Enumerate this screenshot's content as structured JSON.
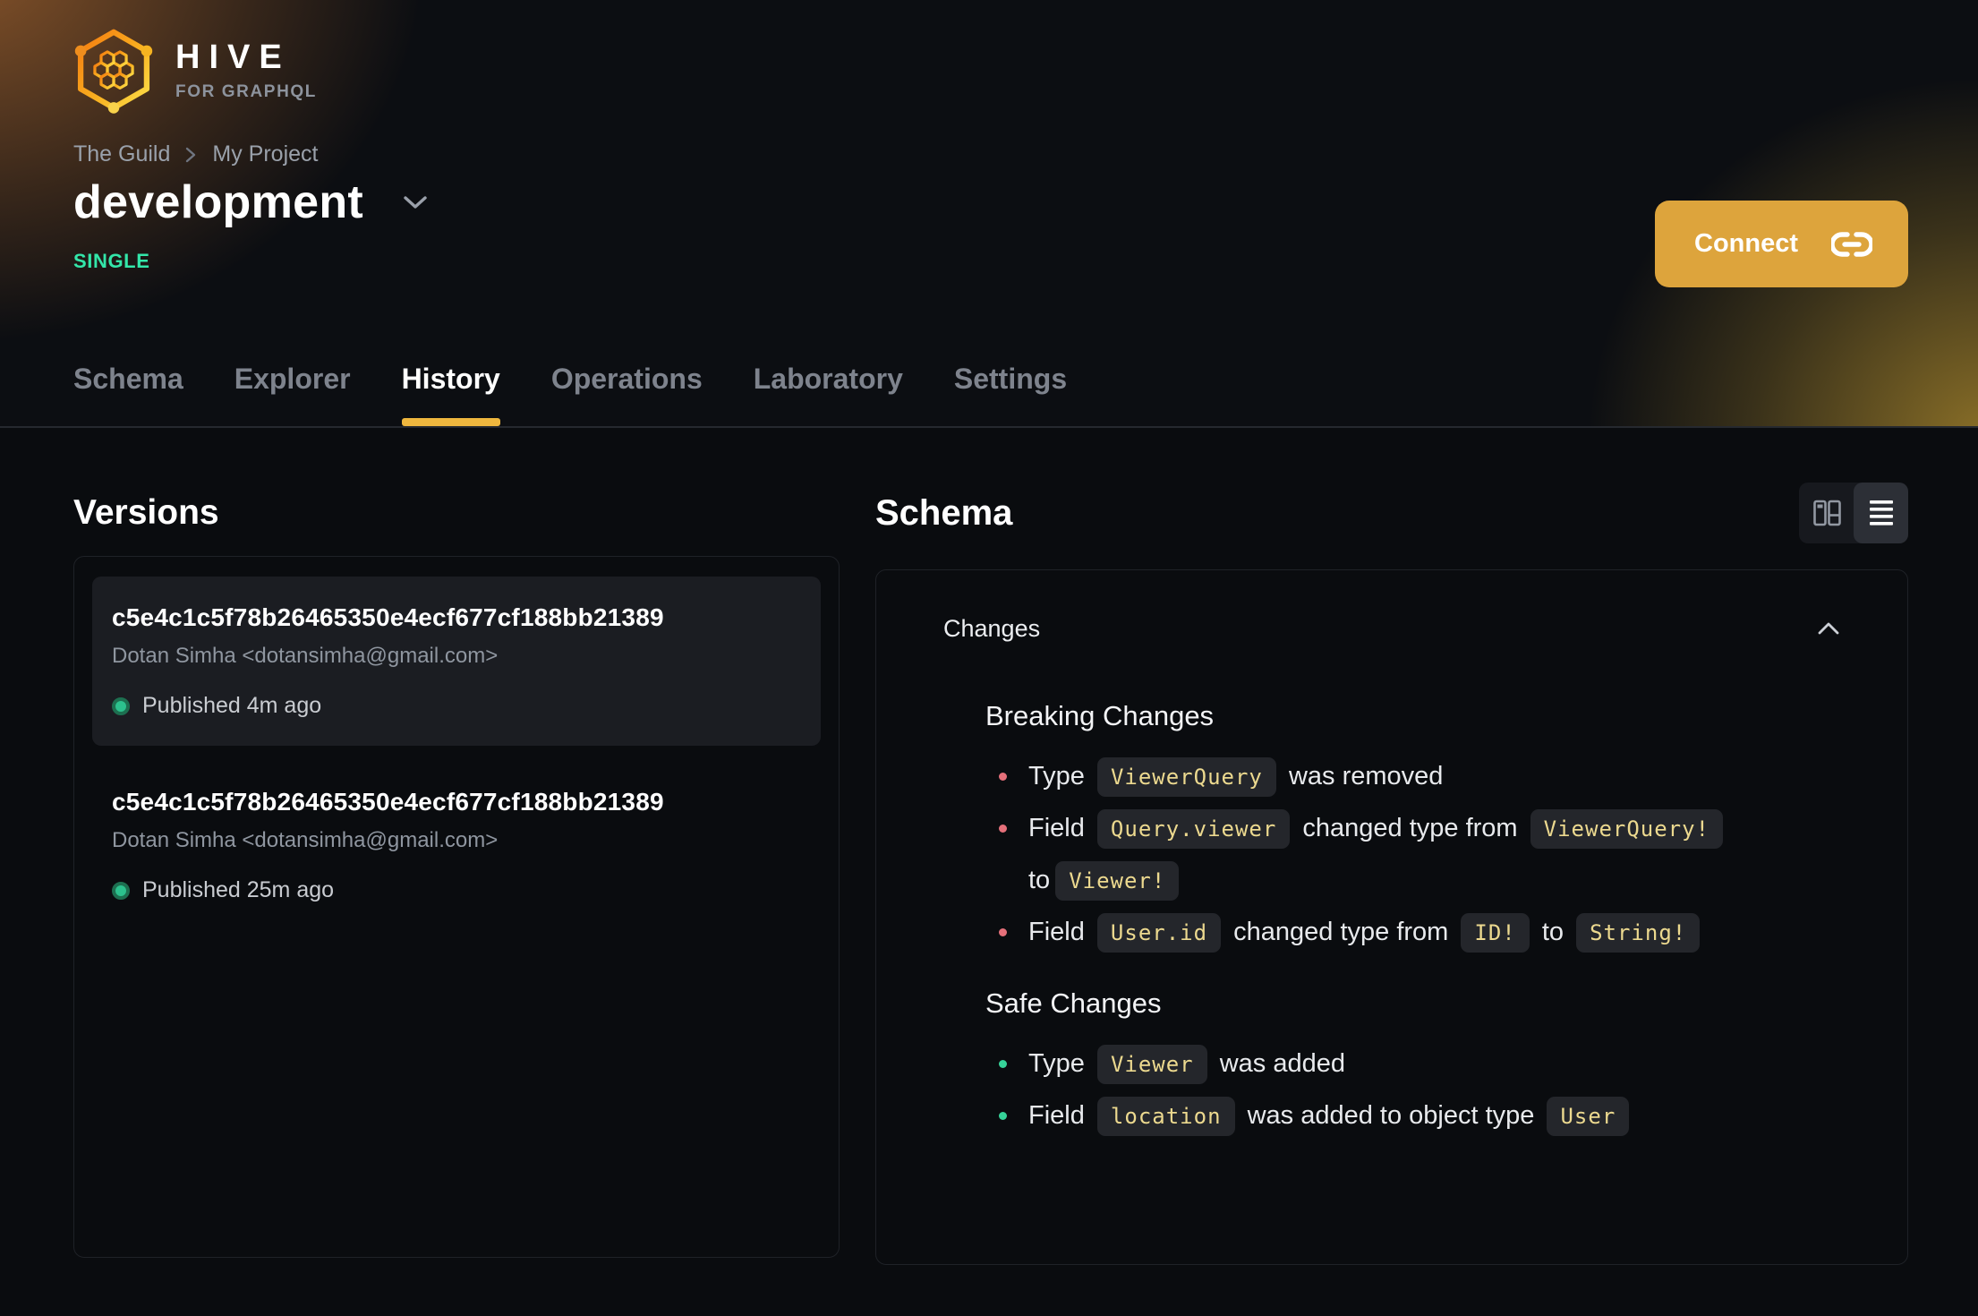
{
  "header": {
    "logo": {
      "title": "HIVE",
      "subtitle": "FOR GRAPHQL"
    },
    "breadcrumb": {
      "org": "The Guild",
      "project": "My Project"
    },
    "target_name": "development",
    "badge": "SINGLE",
    "connect_label": "Connect",
    "tabs": [
      {
        "label": "Schema"
      },
      {
        "label": "Explorer"
      },
      {
        "label": "History"
      },
      {
        "label": "Operations"
      },
      {
        "label": "Laboratory"
      },
      {
        "label": "Settings"
      }
    ],
    "active_tab": "History"
  },
  "versions": {
    "heading": "Versions",
    "items": [
      {
        "hash": "c5e4c1c5f78b26465350e4ecf677cf188bb21389",
        "author": "Dotan Simha <dotansimha@gmail.com>",
        "status": "Published 4m ago",
        "selected": true
      },
      {
        "hash": "c5e4c1c5f78b26465350e4ecf677cf188bb21389",
        "author": "Dotan Simha <dotansimha@gmail.com>",
        "status": "Published 25m ago",
        "selected": false
      }
    ]
  },
  "schema": {
    "heading": "Schema",
    "view_toggle": {
      "options": [
        "diff-view",
        "list-view"
      ],
      "active": "list-view"
    },
    "changes_label": "Changes",
    "breaking": {
      "title": "Breaking Changes",
      "items": [
        {
          "t1": "Type",
          "c1": "ViewerQuery",
          "t2": "was removed"
        },
        {
          "t1": "Field",
          "c1": "Query.viewer",
          "t2": "changed type from",
          "c2": "ViewerQuery!",
          "t3": "to",
          "c3": "Viewer!"
        },
        {
          "t1": "Field",
          "c1": "User.id",
          "t2": "changed type from",
          "c2": "ID!",
          "t3": "to",
          "c3": "String!"
        }
      ]
    },
    "safe": {
      "title": "Safe Changes",
      "items": [
        {
          "t1": "Type",
          "c1": "Viewer",
          "t2": "was added"
        },
        {
          "t1": "Field",
          "c1": "location",
          "t2": "was added to object type",
          "c2": "User"
        }
      ]
    }
  },
  "colors": {
    "accent_yellow": "#efb73e",
    "connect_button": "#dda43c",
    "badge_green": "#33e6a9",
    "breaking_red": "#e5707a",
    "safe_green": "#36d399",
    "chip_text_gold": "#ecd98f",
    "published_dot_green": "#2cc18d"
  }
}
